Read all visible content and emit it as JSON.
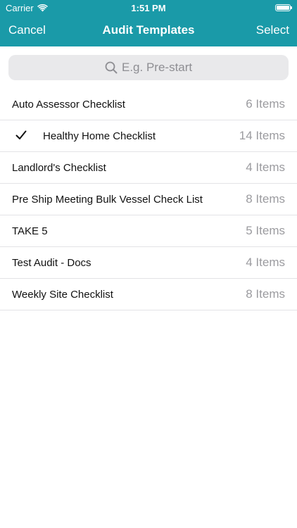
{
  "status_bar": {
    "carrier": "Carrier",
    "time": "1:51 PM"
  },
  "nav": {
    "left_label": "Cancel",
    "title": "Audit Templates",
    "right_label": "Select"
  },
  "search": {
    "placeholder": "E.g. Pre-start",
    "value": ""
  },
  "templates": [
    {
      "name": "Auto Assessor Checklist",
      "count": "6 Items",
      "checked": false
    },
    {
      "name": "Healthy Home Checklist",
      "count": "14 Items",
      "checked": true
    },
    {
      "name": "Landlord's Checklist",
      "count": "4 Items",
      "checked": false
    },
    {
      "name": "Pre Ship Meeting Bulk Vessel Check List",
      "count": "8 Items",
      "checked": false
    },
    {
      "name": "TAKE 5",
      "count": "5 Items",
      "checked": false
    },
    {
      "name": "Test Audit - Docs",
      "count": "4 Items",
      "checked": false
    },
    {
      "name": "Weekly Site Checklist",
      "count": "8 Items",
      "checked": false
    }
  ],
  "colors": {
    "header": "#1a9aa8",
    "secondary_text": "#9b9b9f"
  }
}
